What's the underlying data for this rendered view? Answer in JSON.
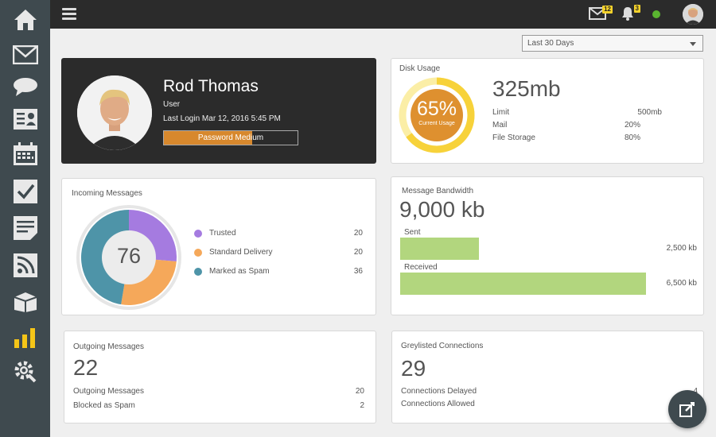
{
  "sidebar": {
    "items": [
      {
        "icon": "home-icon"
      },
      {
        "icon": "mail-icon"
      },
      {
        "icon": "chat-icon"
      },
      {
        "icon": "contacts-icon"
      },
      {
        "icon": "calendar-icon"
      },
      {
        "icon": "tasks-icon"
      },
      {
        "icon": "notes-icon"
      },
      {
        "icon": "rss-icon"
      },
      {
        "icon": "box-icon"
      },
      {
        "icon": "stats-icon",
        "active": true
      },
      {
        "icon": "settings-icon"
      }
    ],
    "active_color": "#f5c518"
  },
  "topbar": {
    "mail_badge": "12",
    "notif_badge": "3",
    "status_color": "#5ab530"
  },
  "period": {
    "selected": "Last 30 Days"
  },
  "profile": {
    "name": "Rod Thomas",
    "role": "User",
    "last_login": "Last Login Mar 12, 2016 5:45 PM",
    "password_strength_label": "Password Medium",
    "password_strength_fraction": 0.66
  },
  "disk": {
    "title": "Disk Usage",
    "percent_label": "65%",
    "percent_value": 0.65,
    "gauge_sub": "Current Usage",
    "total": "325mb",
    "rows": [
      {
        "label": "Limit",
        "value": "500mb"
      },
      {
        "label": "Mail",
        "value": "20%"
      },
      {
        "label": "File Storage",
        "value": "80%"
      }
    ]
  },
  "incoming": {
    "title": "Incoming Messages",
    "total": "76",
    "legend": [
      {
        "label": "Trusted",
        "value": "20",
        "color": "#a57be0"
      },
      {
        "label": "Standard Delivery",
        "value": "20",
        "color": "#f5a85a"
      },
      {
        "label": "Marked as Spam",
        "value": "36",
        "color": "#4e94a8"
      }
    ]
  },
  "bandwidth": {
    "title": "Message Bandwidth",
    "total": "9,000 kb",
    "rows": [
      {
        "label": "Sent",
        "value": "2,500 kb",
        "fraction": 0.32
      },
      {
        "label": "Received",
        "value": "6,500 kb",
        "fraction": 1.0
      }
    ]
  },
  "outgoing": {
    "title": "Outgoing Messages",
    "total": "22",
    "rows": [
      {
        "label": "Outgoing Messages",
        "value": "20"
      },
      {
        "label": "Blocked as Spam",
        "value": "2"
      }
    ]
  },
  "greylisted": {
    "title": "Greylisted Connections",
    "total": "29",
    "rows": [
      {
        "label": "Connections Delayed",
        "value": "4"
      },
      {
        "label": "Connections Allowed",
        "value": ""
      }
    ]
  },
  "fab": {
    "icon": "compose-icon"
  }
}
